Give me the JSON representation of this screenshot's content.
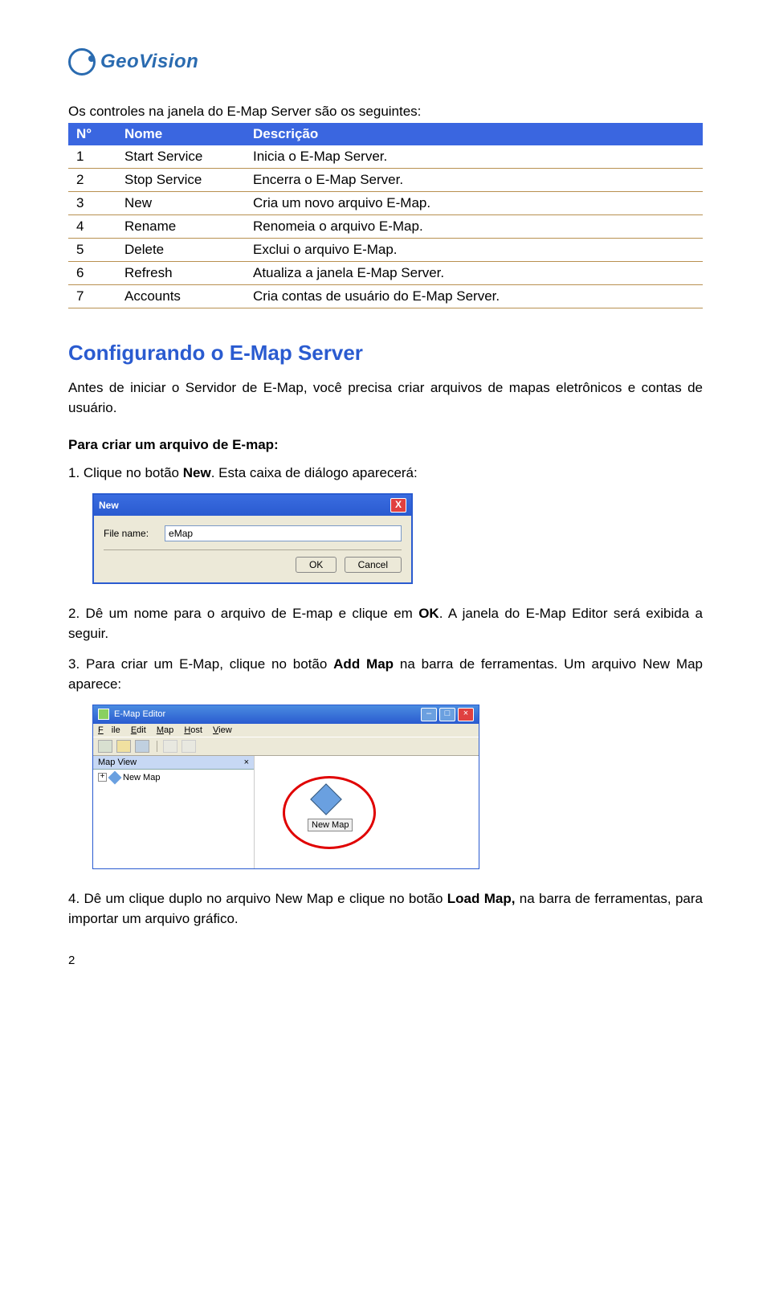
{
  "logo": {
    "brand": "GeoVision"
  },
  "intro": "Os controles na janela do E-Map Server são os seguintes:",
  "table": {
    "headers": {
      "num": "N°",
      "name": "Nome",
      "desc": "Descrição"
    },
    "rows": [
      {
        "num": "1",
        "name": "Start Service",
        "desc": "Inicia o E-Map Server."
      },
      {
        "num": "2",
        "name": "Stop Service",
        "desc": "Encerra o E-Map Server."
      },
      {
        "num": "3",
        "name": "New",
        "desc": "Cria um novo arquivo E-Map."
      },
      {
        "num": "4",
        "name": "Rename",
        "desc": "Renomeia o arquivo E-Map."
      },
      {
        "num": "5",
        "name": "Delete",
        "desc": "Exclui o arquivo E-Map."
      },
      {
        "num": "6",
        "name": "Refresh",
        "desc": "Atualiza a janela E-Map Server."
      },
      {
        "num": "7",
        "name": "Accounts",
        "desc": "Cria contas de usuário do E-Map Server."
      }
    ]
  },
  "section_title": "Configurando o E-Map Server",
  "section_body": "Antes de iniciar o Servidor de E-Map, você precisa criar arquivos de mapas eletrônicos e contas de usuário.",
  "subhead": "Para criar um arquivo de E-map:",
  "step1_a": "1. Clique no botão ",
  "step1_b": "New",
  "step1_c": ". Esta caixa de diálogo aparecerá:",
  "dialog": {
    "title": "New",
    "close": "X",
    "filename_label": "File name:",
    "filename_value": "eMap",
    "ok": "OK",
    "cancel": "Cancel"
  },
  "step2_a": "2. Dê um nome para o arquivo de E-map e clique em ",
  "step2_b": "OK",
  "step2_c": ". A janela do E-Map Editor será exibida a seguir.",
  "step3_a": "3. Para criar um E-Map, clique no botão ",
  "step3_b": "Add Map",
  "step3_c": " na barra de ferramentas. Um arquivo New Map aparece:",
  "editor": {
    "title": "E-Map Editor",
    "menu": {
      "file": "File",
      "edit": "Edit",
      "map": "Map",
      "host": "Host",
      "view": "View"
    },
    "mapview": "Map View",
    "mapview_close": "×",
    "tree_item": "New Map",
    "main_label": "New Map"
  },
  "step4_a": "4. Dê um clique duplo no arquivo New Map e clique no botão ",
  "step4_b": "Load Map,",
  "step4_c": " na barra de ferramentas, para importar um arquivo gráfico.",
  "page_number": "2"
}
